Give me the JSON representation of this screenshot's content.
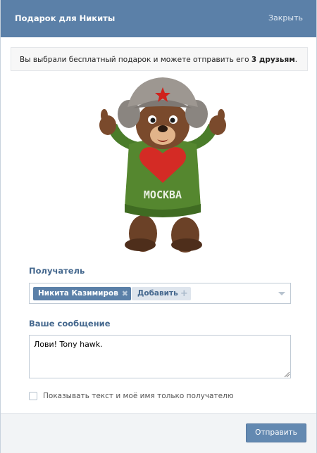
{
  "dialog": {
    "title": "Подарок для Никиты",
    "close_label": "Закрыть"
  },
  "info": {
    "text_before": "Вы выбрали бесплатный подарок и можете отправить его ",
    "text_bold": "3 друзьям",
    "text_after": "."
  },
  "gift": {
    "image_name": "bear-in-sweater-moscow",
    "sweater_text": "МОСКВА"
  },
  "recipient": {
    "label": "Получатель",
    "token_name": "Никита Казимиров",
    "add_label": "Добавить"
  },
  "message": {
    "label": "Ваше сообщение",
    "value": "Лови! Tony hawk."
  },
  "privacy": {
    "checked": false,
    "label": "Показывать текст и моё имя только получателю"
  },
  "footer": {
    "send_label": "Отправить"
  },
  "colors": {
    "header_bg": "#5b80a8",
    "accent": "#45688e",
    "button_bg": "#6389b1"
  }
}
